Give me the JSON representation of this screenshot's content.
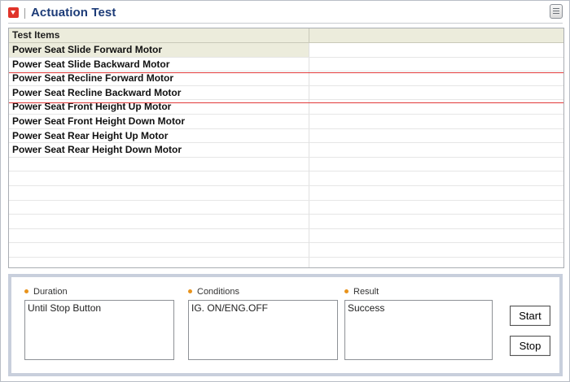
{
  "window": {
    "title": "Actuation Test"
  },
  "table": {
    "columns": [
      "Test Items",
      ""
    ],
    "rows": [
      "Power Seat Slide Forward Motor",
      "Power Seat Slide Backward Motor",
      "Power Seat Recline Forward Motor",
      "Power Seat Recline Backward Motor",
      "Power Seat Front Height Up Motor",
      "Power Seat Front Height Down Motor",
      "Power Seat Rear Height Up Motor",
      "Power Seat Rear Height Down Motor",
      "",
      "",
      "",
      "",
      "",
      "",
      "",
      ""
    ]
  },
  "details": {
    "duration_label": "Duration",
    "duration_value": "Until Stop Button",
    "conditions_label": "Conditions",
    "conditions_value": "IG. ON/ENG.OFF",
    "result_label": "Result",
    "result_value": "Success"
  },
  "buttons": {
    "start": "Start",
    "stop": "Stop"
  },
  "colors": {
    "accent": "#e0342a",
    "title": "#1d3c78",
    "highlight": "#e23a3a",
    "bullet": "#e8931c"
  }
}
